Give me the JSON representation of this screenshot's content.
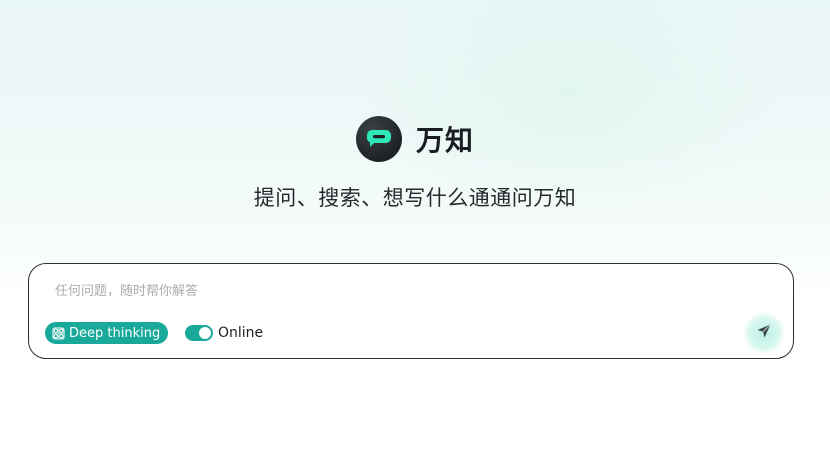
{
  "brand": {
    "name": "万知",
    "logo_icon": "chat-bubble-icon",
    "accent_color": "#2ee6b8"
  },
  "tagline": "提问、搜索、想写什么通通问万知",
  "composer": {
    "placeholder": "任何问题，随时帮你解答",
    "value": "",
    "deep_thinking": {
      "label": "Deep thinking",
      "icon": "atom-icon",
      "active": true
    },
    "online": {
      "label": "Online",
      "enabled": true
    },
    "send_icon": "send-arrow-icon"
  },
  "colors": {
    "accent": "#18a99a",
    "send_bg": "#c6f3e8"
  }
}
